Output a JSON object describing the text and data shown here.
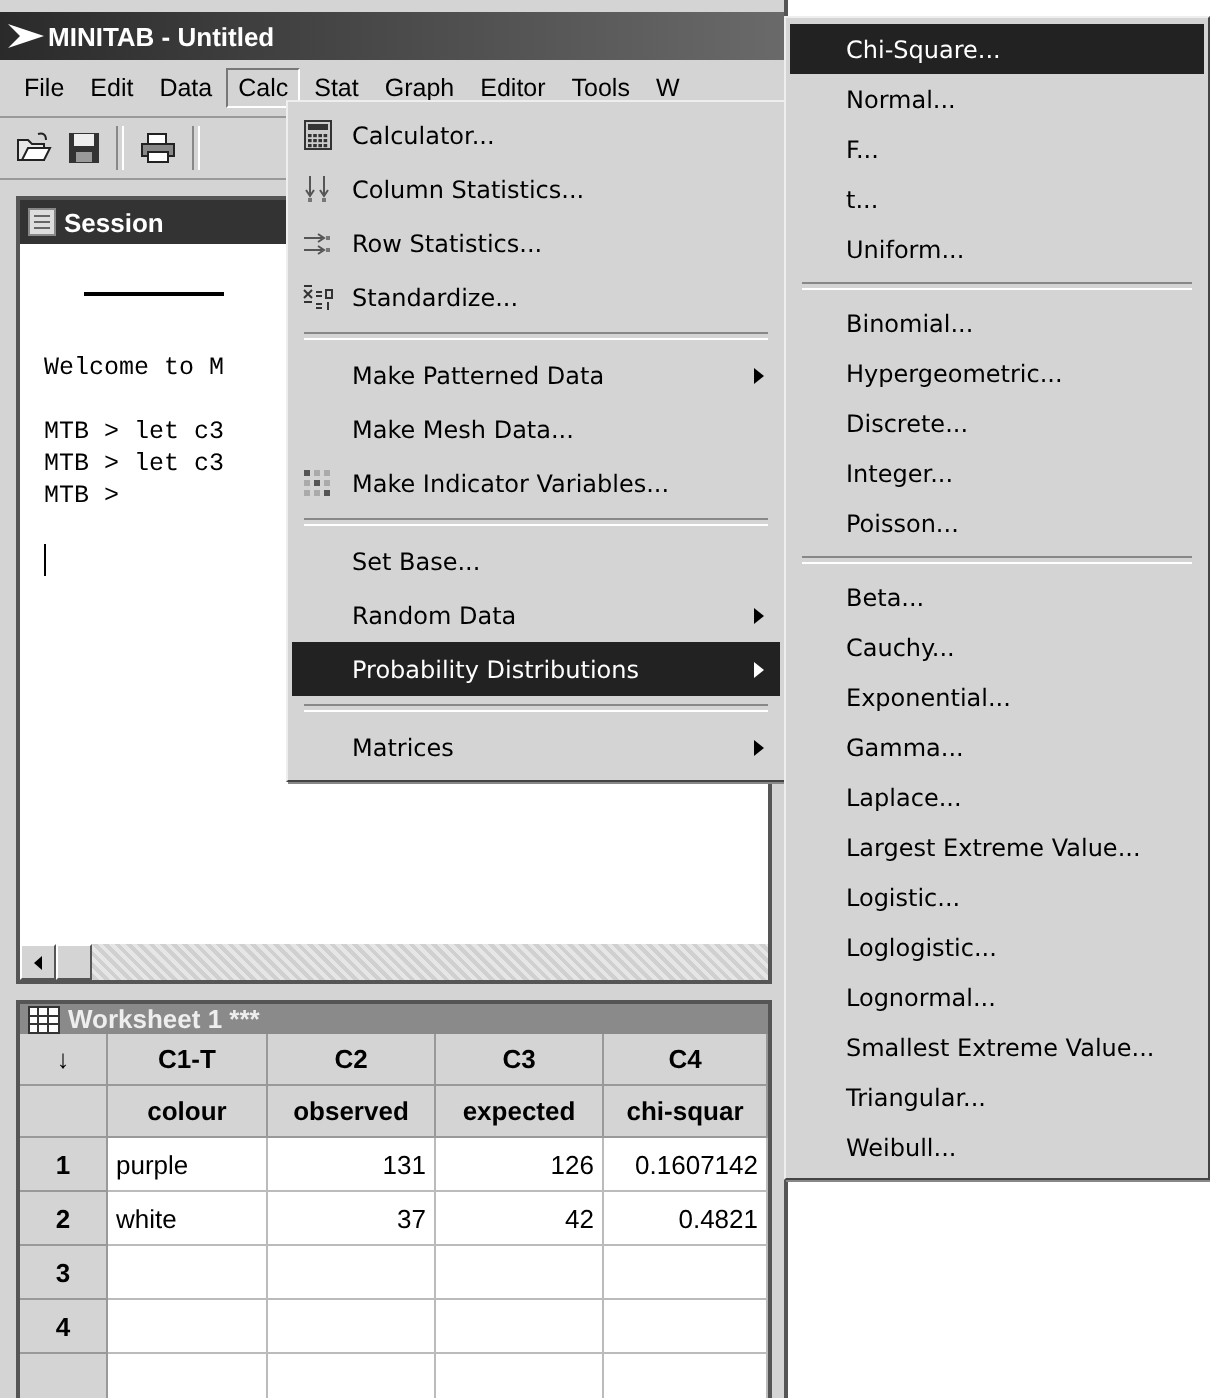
{
  "window": {
    "title": "MINITAB - Untitled"
  },
  "menu_bar": [
    {
      "label": "File",
      "selected": false
    },
    {
      "label": "Edit",
      "selected": false
    },
    {
      "label": "Data",
      "selected": false
    },
    {
      "label": "Calc",
      "selected": true
    },
    {
      "label": "Stat",
      "selected": false
    },
    {
      "label": "Graph",
      "selected": false
    },
    {
      "label": "Editor",
      "selected": false
    },
    {
      "label": "Tools",
      "selected": false
    },
    {
      "label": "W",
      "selected": false
    }
  ],
  "session": {
    "title": "Session",
    "lines": [
      "Welcome to M",
      "MTB > let c3",
      "MTB > let c3",
      "MTB >"
    ]
  },
  "calc_menu": [
    {
      "kind": "item",
      "label": "Calculator...",
      "submenu": false,
      "selected": false
    },
    {
      "kind": "item",
      "label": "Column Statistics...",
      "submenu": false,
      "selected": false
    },
    {
      "kind": "item",
      "label": "Row Statistics...",
      "submenu": false,
      "selected": false
    },
    {
      "kind": "item",
      "label": "Standardize...",
      "submenu": false,
      "selected": false
    },
    {
      "kind": "separator"
    },
    {
      "kind": "item",
      "label": "Make Patterned Data",
      "submenu": true,
      "selected": false
    },
    {
      "kind": "item",
      "label": "Make Mesh Data...",
      "submenu": false,
      "selected": false
    },
    {
      "kind": "item",
      "label": "Make Indicator Variables...",
      "submenu": false,
      "selected": false
    },
    {
      "kind": "separator"
    },
    {
      "kind": "item",
      "label": "Set Base...",
      "submenu": false,
      "selected": false
    },
    {
      "kind": "item",
      "label": "Random Data",
      "submenu": true,
      "selected": false
    },
    {
      "kind": "item",
      "label": "Probability Distributions",
      "submenu": true,
      "selected": true
    },
    {
      "kind": "separator"
    },
    {
      "kind": "item",
      "label": "Matrices",
      "submenu": true,
      "selected": false
    }
  ],
  "distributions_menu": [
    {
      "kind": "item",
      "label": "Chi-Square...",
      "selected": true
    },
    {
      "kind": "item",
      "label": "Normal...",
      "selected": false
    },
    {
      "kind": "item",
      "label": "F...",
      "selected": false
    },
    {
      "kind": "item",
      "label": "t...",
      "selected": false
    },
    {
      "kind": "item",
      "label": "Uniform...",
      "selected": false
    },
    {
      "kind": "separator"
    },
    {
      "kind": "item",
      "label": "Binomial...",
      "selected": false
    },
    {
      "kind": "item",
      "label": "Hypergeometric...",
      "selected": false
    },
    {
      "kind": "item",
      "label": "Discrete...",
      "selected": false
    },
    {
      "kind": "item",
      "label": "Integer...",
      "selected": false
    },
    {
      "kind": "item",
      "label": "Poisson...",
      "selected": false
    },
    {
      "kind": "separator"
    },
    {
      "kind": "item",
      "label": "Beta...",
      "selected": false
    },
    {
      "kind": "item",
      "label": "Cauchy...",
      "selected": false
    },
    {
      "kind": "item",
      "label": "Exponential...",
      "selected": false
    },
    {
      "kind": "item",
      "label": "Gamma...",
      "selected": false
    },
    {
      "kind": "item",
      "label": "Laplace...",
      "selected": false
    },
    {
      "kind": "item",
      "label": "Largest Extreme Value...",
      "selected": false
    },
    {
      "kind": "item",
      "label": "Logistic...",
      "selected": false
    },
    {
      "kind": "item",
      "label": "Loglogistic...",
      "selected": false
    },
    {
      "kind": "item",
      "label": "Lognormal...",
      "selected": false
    },
    {
      "kind": "item",
      "label": "Smallest Extreme Value...",
      "selected": false
    },
    {
      "kind": "item",
      "label": "Triangular...",
      "selected": false
    },
    {
      "kind": "item",
      "label": "Weibull...",
      "selected": false
    }
  ],
  "worksheet": {
    "title": "Worksheet 1 ***",
    "columns": [
      {
        "id": "↓"
      },
      {
        "id": "C1-T",
        "name": "colour"
      },
      {
        "id": "C2",
        "name": "observed"
      },
      {
        "id": "C3",
        "name": "expected"
      },
      {
        "id": "C4",
        "name": "chi-squar"
      }
    ],
    "rows": [
      {
        "number": "1",
        "cells": [
          "purple",
          "131",
          "126",
          "0.1607142"
        ]
      },
      {
        "number": "2",
        "cells": [
          "white",
          "37",
          "42",
          "0.4821"
        ]
      },
      {
        "number": "3",
        "cells": [
          "",
          "",
          "",
          ""
        ]
      },
      {
        "number": "4",
        "cells": [
          "",
          "",
          "",
          ""
        ]
      },
      {
        "number": "",
        "cells": [
          "",
          "",
          "",
          ""
        ]
      }
    ]
  }
}
